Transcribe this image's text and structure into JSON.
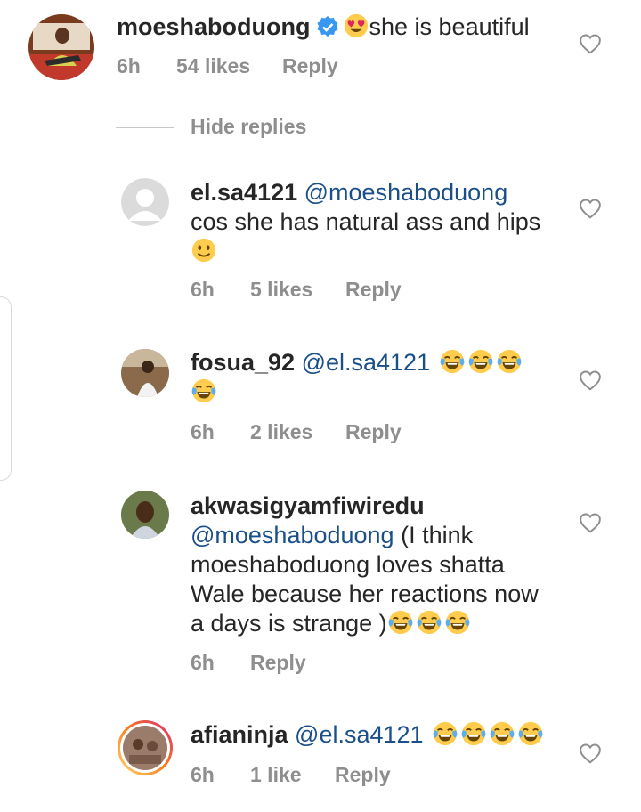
{
  "comments": [
    {
      "username": "moeshaboduong",
      "verified": true,
      "lead_emoji": "heart-eyes-emoji",
      "text": "she is beautiful",
      "time": "6h",
      "likes": "54 likes",
      "reply": "Reply"
    }
  ],
  "replies_toggle": "Hide replies",
  "replies": [
    {
      "username": "el.sa4121",
      "mention": "@moeshaboduong",
      "text": "cos she has natural ass and hips",
      "emoji": "slightly-smiling-emoji",
      "time": "6h",
      "likes": "5 likes",
      "reply": "Reply"
    },
    {
      "username": "fosua_92",
      "mention": "@el.sa4121",
      "emoji": "tears-of-joy-emoji",
      "time": "6h",
      "likes": "2 likes",
      "reply": "Reply"
    },
    {
      "username": "akwasigyamfiwiredu",
      "mention": "@moeshaboduong",
      "text_line1": "(I think",
      "text_line2": "moeshaboduong loves shatta",
      "text_line3": "Wale because her reactions now",
      "text_line4": "a days is strange )",
      "emoji": "tears-of-joy-emoji",
      "time": "6h",
      "reply": "Reply"
    },
    {
      "username": "afianinja",
      "mention": "@el.sa4121",
      "emoji": "tears-of-joy-emoji",
      "time": "6h",
      "likes": "1 like",
      "reply": "Reply"
    }
  ],
  "colors": {
    "mention": "#1a4f8a",
    "meta": "#8e8e8e",
    "verified": "#3897f0",
    "story_ring": "#d6249f"
  }
}
